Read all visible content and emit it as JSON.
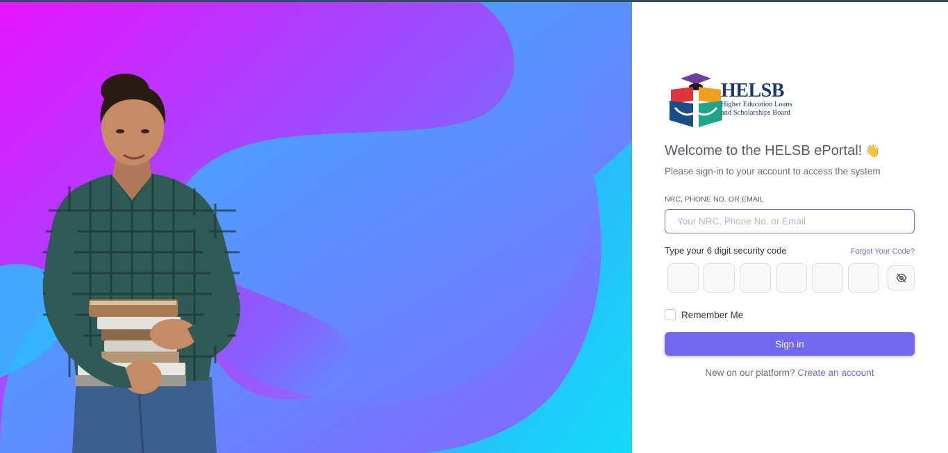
{
  "brand": {
    "name": "HELSB",
    "subtitle_line1": "Higher Education Loans",
    "subtitle_line2": "and Scholarships Board"
  },
  "login": {
    "welcome": "Welcome to the HELSB ePortal!",
    "wave_emoji": "👋",
    "subtitle": "Please sign-in to your account to access the system",
    "id_label": "NRC, PHONE NO. OR EMAIL",
    "id_placeholder": "Your NRC, Phone No. or Email",
    "id_value": "",
    "code_label": "Type your 6 digit security code",
    "forgot_link": "Forgot Your Code?",
    "code_digits": [
      "",
      "",
      "",
      "",
      "",
      ""
    ],
    "toggle_icon": "eye-off-icon",
    "remember_label": "Remember Me",
    "remember_checked": false,
    "signin_label": "Sign in",
    "new_prompt": "New on our platform?",
    "create_link": "Create an account"
  },
  "colors": {
    "primary": "#7367f0",
    "text": "#5d596c",
    "hero_start": "#e614ff",
    "hero_end": "#12d8f8"
  }
}
